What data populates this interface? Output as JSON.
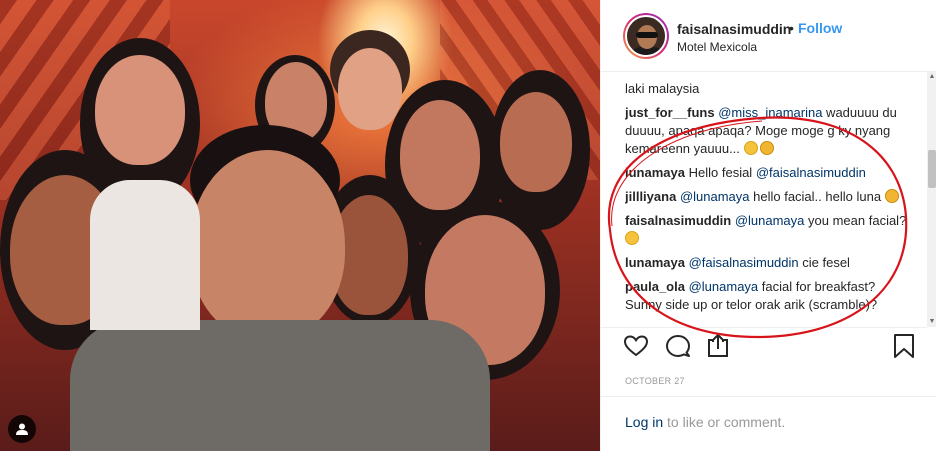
{
  "post": {
    "username": "faisalnasimuddin",
    "separator": "•",
    "follow_label": "Follow",
    "location": "Motel Mexicola"
  },
  "comments": [
    {
      "text": "laki malaysia"
    },
    {
      "user": "just_for__funs",
      "mention": "@miss_inamarina",
      "text": " waduuuu du duuuu, apaqa apaqa? Moge moge g ky nyang kemareenn yauuu... ",
      "emoji": [
        "grinning-squint-emoji",
        "laughing-emoji"
      ]
    },
    {
      "user": "lunamaya",
      "text": "Hello fesial ",
      "mention": "@faisalnasimuddin"
    },
    {
      "user": "jillliyana",
      "mention": "@lunamaya",
      "text": " hello facial.. hello luna ",
      "emoji": [
        "laughing-emoji"
      ]
    },
    {
      "user": "faisalnasimuddin",
      "mention": "@lunamaya",
      "text": " you mean facial? ",
      "emoji": [
        "tongue-out-emoji"
      ]
    },
    {
      "user": "lunamaya",
      "mention": "@faisalnasimuddin",
      "text": " cie fesel"
    },
    {
      "user": "paula_ola",
      "mention": "@lunamaya",
      "text": " facial for breakfast? Sunny side up or telor orak arik (scramble)?"
    }
  ],
  "actions": {
    "like_icon": "heart-icon",
    "comment_icon": "comment-bubble-icon",
    "share_icon": "share-icon",
    "save_icon": "bookmark-icon"
  },
  "date": "OCTOBER 27",
  "login": {
    "link": "Log in",
    "rest": " to like or comment."
  },
  "colors": {
    "link_blue": "#3897f0",
    "mention_blue": "#003569",
    "annotation_red": "#d8141b"
  }
}
